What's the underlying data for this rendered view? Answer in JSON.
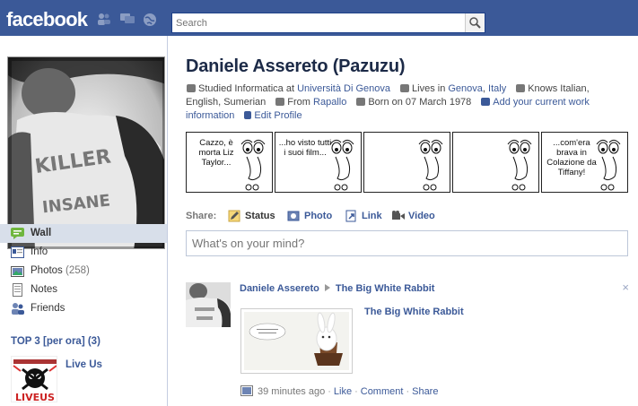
{
  "header": {
    "logo": "facebook",
    "search_placeholder": "Search"
  },
  "icons": {
    "friend_requests": "friend-requests-icon",
    "messages": "messages-icon",
    "notifications": "notifications-globe-icon",
    "search": "magnifier-icon"
  },
  "colors": {
    "brand_blue": "#3b5998",
    "nav_active": "#d8dfea",
    "link": "#3b5998"
  },
  "sidebar": {
    "items": [
      {
        "label": "Wall",
        "icon": "wall-icon",
        "active": true
      },
      {
        "label": "Info",
        "icon": "info-icon"
      },
      {
        "label": "Photos",
        "count": "(258)",
        "icon": "photos-icon"
      },
      {
        "label": "Notes",
        "icon": "notes-icon"
      },
      {
        "label": "Friends",
        "icon": "friends-icon"
      }
    ],
    "top3_title": "TOP 3 [per ora] (3)",
    "top3_items": [
      {
        "label": "Live Us",
        "image_text": "LIVEUS"
      }
    ]
  },
  "profile": {
    "name": "Daniele Assereto (Pazuzu)",
    "studied_prefix": "Studied Informatica at",
    "school": "Università Di Genova",
    "lives_prefix": "Lives in",
    "city": "Genova",
    "country": "Italy",
    "knows": "Knows Italian, English, Sumerian",
    "from_prefix": "From",
    "hometown": "Rapallo",
    "born": "Born on 07 March 1978",
    "add_work": "Add your current work information",
    "edit_profile": "Edit Profile"
  },
  "comic_strip": [
    {
      "text": "Cazzo, è morta Liz Taylor..."
    },
    {
      "text": "...ho visto tutti i suoi film..."
    },
    {
      "text": ""
    },
    {
      "text": ""
    },
    {
      "text": "...com'era brava in Colazione da Tiffany!"
    }
  ],
  "share": {
    "label": "Share:",
    "options": [
      {
        "label": "Status",
        "icon": "status-icon",
        "selected": true
      },
      {
        "label": "Photo",
        "icon": "photo-icon"
      },
      {
        "label": "Link",
        "icon": "link-icon"
      },
      {
        "label": "Video",
        "icon": "video-icon"
      }
    ],
    "placeholder": "What's on your mind?"
  },
  "story": {
    "author": "Daniele Assereto",
    "target": "The Big White Rabbit",
    "attachment_title": "The Big White Rabbit",
    "time": "39 minutes ago",
    "actions": [
      "Like",
      "Comment",
      "Share"
    ],
    "close": "×"
  }
}
